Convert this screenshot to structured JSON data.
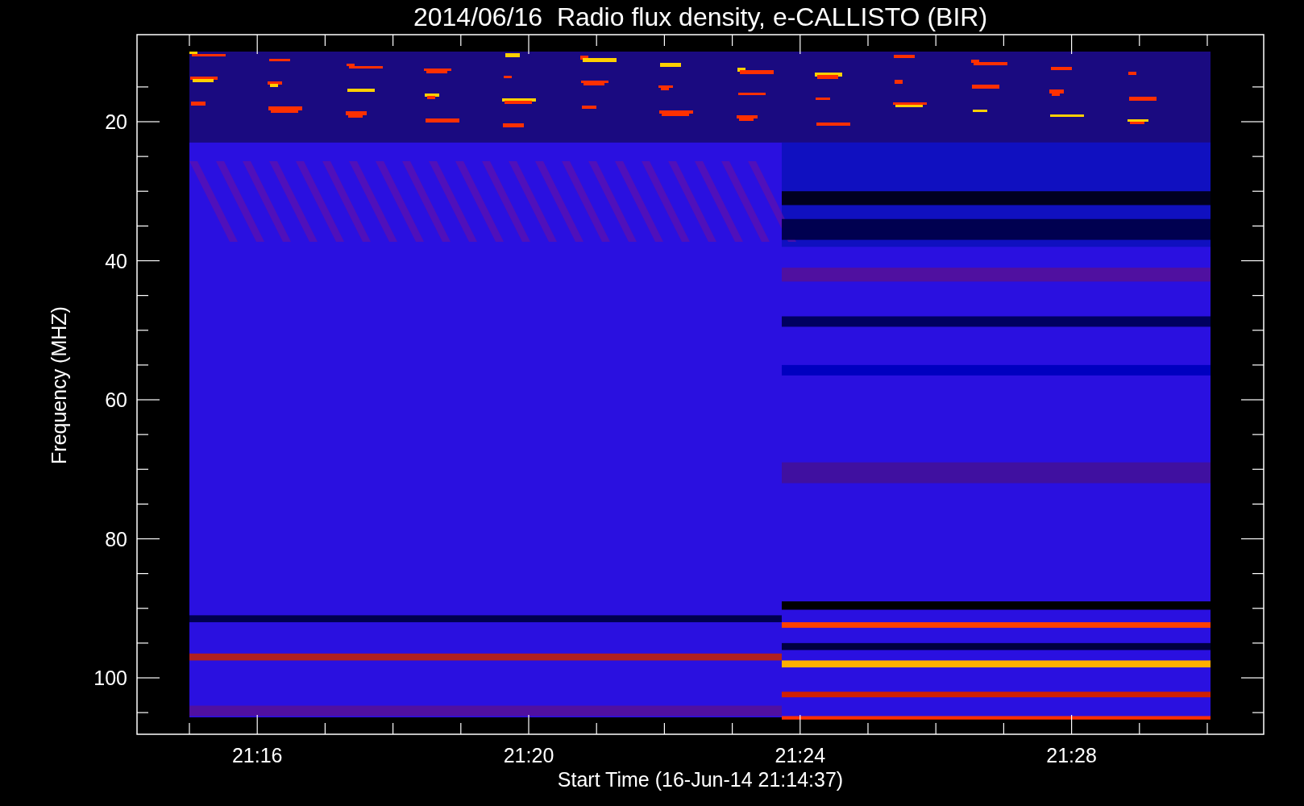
{
  "title": "2014/06/16  Radio flux density, e-CALLISTO (BIR)",
  "y_axis": {
    "label": "Frequency (MHZ)",
    "ticks": [
      "20",
      "40",
      "60",
      "80",
      "100"
    ]
  },
  "x_axis": {
    "label": "Start Time (16-Jun-14 21:14:37)",
    "ticks": [
      "21:16",
      "21:20",
      "21:24",
      "21:28"
    ]
  }
}
